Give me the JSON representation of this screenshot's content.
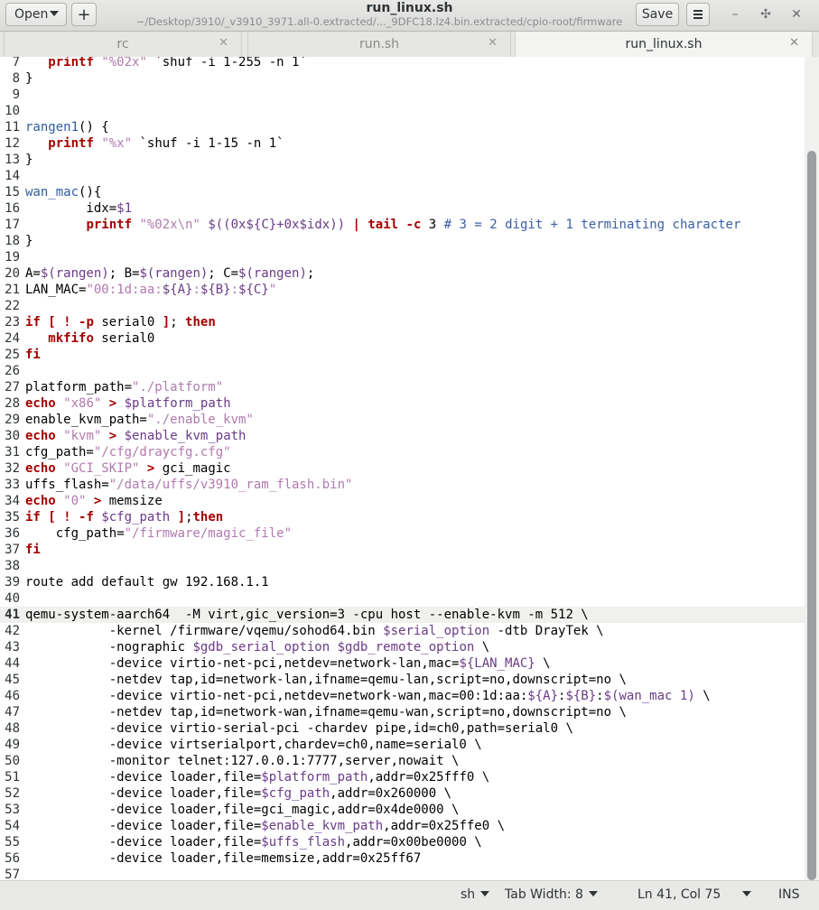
{
  "header": {
    "open_label": "Open",
    "new_tab_glyph": "+",
    "save_label": "Save",
    "title": "run_linux.sh",
    "path": "~/Desktop/3910/_v3910_3971.all-0.extracted/..._9DFC18.lz4.bin.extracted/cpio-root/firmware",
    "minimize_glyph": "–",
    "maximize_glyph": "✣",
    "close_glyph": "✕"
  },
  "tabs": [
    {
      "label": "rc",
      "active": false
    },
    {
      "label": "run.sh",
      "active": false
    },
    {
      "label": "run_linux.sh",
      "active": true
    }
  ],
  "tab_close_glyph": "✕",
  "editor": {
    "current_line": 41,
    "lines": [
      {
        "n": "7",
        "code": "   printf \"%02x\" `shuf -i 1-255 -n 1`"
      },
      {
        "n": "8",
        "code": "}"
      },
      {
        "n": "9",
        "code": ""
      },
      {
        "n": "10",
        "code": ""
      },
      {
        "n": "11",
        "code": "rangen1() {"
      },
      {
        "n": "12",
        "code": "   printf \"%x\" `shuf -i 1-15 -n 1`"
      },
      {
        "n": "13",
        "code": "}"
      },
      {
        "n": "14",
        "code": ""
      },
      {
        "n": "15",
        "code": "wan_mac(){"
      },
      {
        "n": "16",
        "code": "        idx=$1"
      },
      {
        "n": "17",
        "code": "        printf \"%02x\\n\" $((0x${C}+0x$idx)) | tail -c 3 # 3 = 2 digit + 1 terminating character"
      },
      {
        "n": "18",
        "code": "}"
      },
      {
        "n": "19",
        "code": ""
      },
      {
        "n": "20",
        "code": "A=$(rangen); B=$(rangen); C=$(rangen);"
      },
      {
        "n": "21",
        "code": "LAN_MAC=\"00:1d:aa:${A}:${B}:${C}\""
      },
      {
        "n": "22",
        "code": ""
      },
      {
        "n": "23",
        "code": "if [ ! -p serial0 ]; then"
      },
      {
        "n": "24",
        "code": "   mkfifo serial0"
      },
      {
        "n": "25",
        "code": "fi"
      },
      {
        "n": "26",
        "code": ""
      },
      {
        "n": "27",
        "code": "platform_path=\"./platform\""
      },
      {
        "n": "28",
        "code": "echo \"x86\" > $platform_path"
      },
      {
        "n": "29",
        "code": "enable_kvm_path=\"./enable_kvm\""
      },
      {
        "n": "30",
        "code": "echo \"kvm\" > $enable_kvm_path"
      },
      {
        "n": "31",
        "code": "cfg_path=\"/cfg/draycfg.cfg\""
      },
      {
        "n": "32",
        "code": "echo \"GCI_SKIP\" > gci_magic"
      },
      {
        "n": "33",
        "code": "uffs_flash=\"/data/uffs/v3910_ram_flash.bin\""
      },
      {
        "n": "34",
        "code": "echo \"0\" > memsize"
      },
      {
        "n": "35",
        "code": "if [ ! -f $cfg_path ];then"
      },
      {
        "n": "36",
        "code": "    cfg_path=\"/firmware/magic_file\""
      },
      {
        "n": "37",
        "code": "fi"
      },
      {
        "n": "38",
        "code": ""
      },
      {
        "n": "39",
        "code": "route add default gw 192.168.1.1"
      },
      {
        "n": "40",
        "code": ""
      },
      {
        "n": "41",
        "code": "qemu-system-aarch64  -M virt,gic_version=3 -cpu host --enable-kvm -m 512 \\"
      },
      {
        "n": "42",
        "code": "           -kernel /firmware/vqemu/sohod64.bin $serial_option -dtb DrayTek \\"
      },
      {
        "n": "43",
        "code": "           -nographic $gdb_serial_option $gdb_remote_option \\"
      },
      {
        "n": "44",
        "code": "           -device virtio-net-pci,netdev=network-lan,mac=${LAN_MAC} \\"
      },
      {
        "n": "45",
        "code": "           -netdev tap,id=network-lan,ifname=qemu-lan,script=no,downscript=no \\"
      },
      {
        "n": "46",
        "code": "           -device virtio-net-pci,netdev=network-wan,mac=00:1d:aa:${A}:${B}:$(wan_mac 1) \\"
      },
      {
        "n": "47",
        "code": "           -netdev tap,id=network-wan,ifname=qemu-wan,script=no,downscript=no \\"
      },
      {
        "n": "48",
        "code": "           -device virtio-serial-pci -chardev pipe,id=ch0,path=serial0 \\"
      },
      {
        "n": "49",
        "code": "           -device virtserialport,chardev=ch0,name=serial0 \\"
      },
      {
        "n": "50",
        "code": "           -monitor telnet:127.0.0.1:7777,server,nowait \\"
      },
      {
        "n": "51",
        "code": "           -device loader,file=$platform_path,addr=0x25fff0 \\"
      },
      {
        "n": "52",
        "code": "           -device loader,file=$cfg_path,addr=0x260000 \\"
      },
      {
        "n": "53",
        "code": "           -device loader,file=gci_magic,addr=0x4de0000 \\"
      },
      {
        "n": "54",
        "code": "           -device loader,file=$enable_kvm_path,addr=0x25ffe0 \\"
      },
      {
        "n": "55",
        "code": "           -device loader,file=$uffs_flash,addr=0x00be0000 \\"
      },
      {
        "n": "56",
        "code": "           -device loader,file=memsize,addr=0x25ff67"
      },
      {
        "n": "57",
        "code": ""
      }
    ]
  },
  "statusbar": {
    "language": "sh",
    "tab_width": "Tab Width: 8",
    "position": "Ln 41, Col 75",
    "mode": "INS"
  },
  "colors": {
    "keyword": "#a40000",
    "string": "#b07bae",
    "variable": "#6a3b87",
    "function": "#2f5d9c"
  }
}
